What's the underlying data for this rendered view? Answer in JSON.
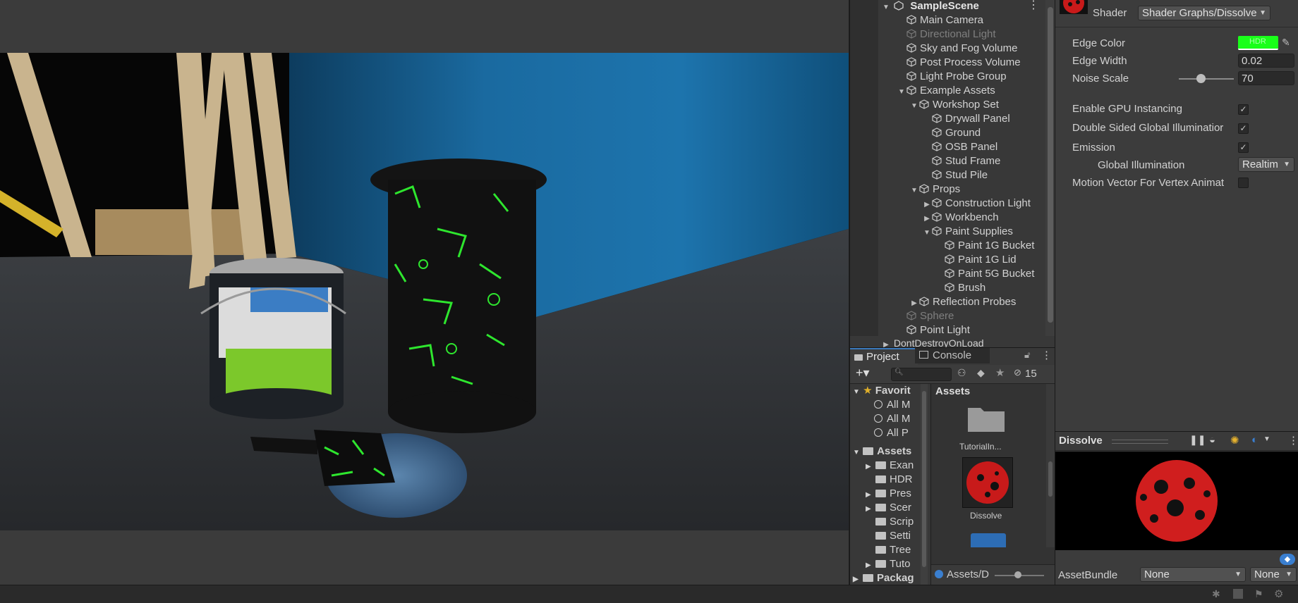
{
  "hierarchy": {
    "scene_name": "SampleScene",
    "items": [
      {
        "label": "Main Camera",
        "depth": 1,
        "arrow": "",
        "dim": false
      },
      {
        "label": "Directional Light",
        "depth": 1,
        "arrow": "",
        "dim": true
      },
      {
        "label": "Sky and Fog Volume",
        "depth": 1,
        "arrow": "",
        "dim": false
      },
      {
        "label": "Post Process Volume",
        "depth": 1,
        "arrow": "",
        "dim": false
      },
      {
        "label": "Light Probe Group",
        "depth": 1,
        "arrow": "",
        "dim": false
      },
      {
        "label": "Example Assets",
        "depth": 1,
        "arrow": "▼",
        "dim": false
      },
      {
        "label": "Workshop Set",
        "depth": 2,
        "arrow": "▼",
        "dim": false
      },
      {
        "label": "Drywall Panel",
        "depth": 3,
        "arrow": "",
        "dim": false
      },
      {
        "label": "Ground",
        "depth": 3,
        "arrow": "",
        "dim": false
      },
      {
        "label": "OSB Panel",
        "depth": 3,
        "arrow": "",
        "dim": false
      },
      {
        "label": "Stud Frame",
        "depth": 3,
        "arrow": "",
        "dim": false
      },
      {
        "label": "Stud Pile",
        "depth": 3,
        "arrow": "",
        "dim": false
      },
      {
        "label": "Props",
        "depth": 2,
        "arrow": "▼",
        "dim": false
      },
      {
        "label": "Construction Light",
        "depth": 3,
        "arrow": "▶",
        "dim": false
      },
      {
        "label": "Workbench",
        "depth": 3,
        "arrow": "▶",
        "dim": false
      },
      {
        "label": "Paint Supplies",
        "depth": 3,
        "arrow": "▼",
        "dim": false
      },
      {
        "label": "Paint 1G Bucket",
        "depth": 4,
        "arrow": "",
        "dim": false
      },
      {
        "label": "Paint 1G Lid",
        "depth": 4,
        "arrow": "",
        "dim": false
      },
      {
        "label": "Paint 5G Bucket",
        "depth": 4,
        "arrow": "",
        "dim": false
      },
      {
        "label": "Brush",
        "depth": 4,
        "arrow": "",
        "dim": false
      },
      {
        "label": "Reflection Probes",
        "depth": 2,
        "arrow": "▶",
        "dim": false
      },
      {
        "label": "Sphere",
        "depth": 1,
        "arrow": "",
        "dim": true
      },
      {
        "label": "Point Light",
        "depth": 1,
        "arrow": "",
        "dim": false
      }
    ],
    "ddol_label": "DontDestroyOnLoad"
  },
  "project": {
    "tab_project": "Project",
    "tab_console": "Console",
    "hidden_count": "15",
    "favorites_label": "Favorit",
    "favorites": [
      "All M",
      "All M",
      "All P"
    ],
    "assets_label": "Assets",
    "asset_folders": [
      {
        "label": "Exan",
        "arrow": "▶"
      },
      {
        "label": "HDR",
        "arrow": ""
      },
      {
        "label": "Pres",
        "arrow": "▶"
      },
      {
        "label": "Scer",
        "arrow": "▶"
      },
      {
        "label": "Scrip",
        "arrow": ""
      },
      {
        "label": "Setti",
        "arrow": ""
      },
      {
        "label": "Tree",
        "arrow": ""
      },
      {
        "label": "Tuto",
        "arrow": "▶"
      },
      {
        "label": "Packag",
        "arrow": "▶"
      }
    ],
    "right_header": "Assets",
    "grid_items": [
      "TutorialIn...",
      "Dissolve"
    ],
    "path_label": "Assets/D"
  },
  "inspector": {
    "shader_label": "Shader",
    "shader_value": "Shader Graphs/Dissolve",
    "edge_color_label": "Edge Color",
    "edge_color_badge": "HDR",
    "edge_color_hex": "#19ff19",
    "edge_width_label": "Edge Width",
    "edge_width_value": "0.02",
    "noise_scale_label": "Noise Scale",
    "noise_scale_value": "70",
    "gpu_instancing_label": "Enable GPU Instancing",
    "double_sided_gi_label": "Double Sided Global Illuminatior",
    "emission_label": "Emission",
    "global_illumination_label": "Global Illumination",
    "global_illumination_value": "Realtim",
    "motion_vector_label": "Motion Vector For Vertex Animat"
  },
  "preview": {
    "title": "Dissolve",
    "assetbundle_label": "AssetBundle",
    "assetbundle_value": "None",
    "assetbundle_variant": "None"
  }
}
